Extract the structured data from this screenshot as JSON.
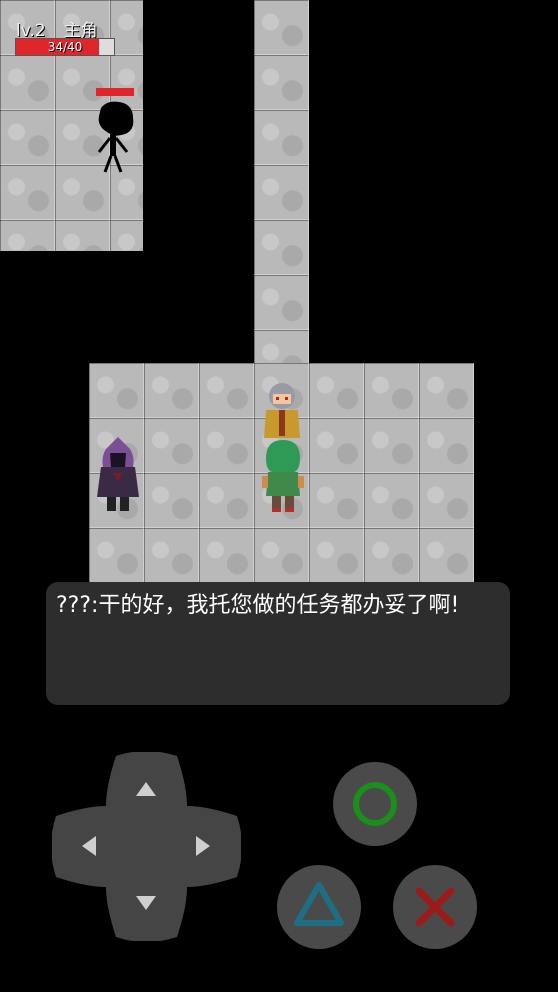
{
  "hud": {
    "level": "lv.2",
    "name": "主角",
    "hp_text": "34/40",
    "hp_fraction": 0.85
  },
  "dialog": {
    "text": "???:干的好，我托您做的任务都办妥了啊!"
  },
  "controls": {
    "dpad_icon": "dpad-icon",
    "confirm_icon": "circle-icon",
    "menu_icon": "triangle-icon",
    "cancel_icon": "cross-icon"
  },
  "colors": {
    "hp_red": "#e0262a",
    "circle_green": "#1a8f1a",
    "triangle_teal": "#1e6f86",
    "cross_red": "#9b1b1b",
    "dialog_bg": "#2d2d2d"
  }
}
